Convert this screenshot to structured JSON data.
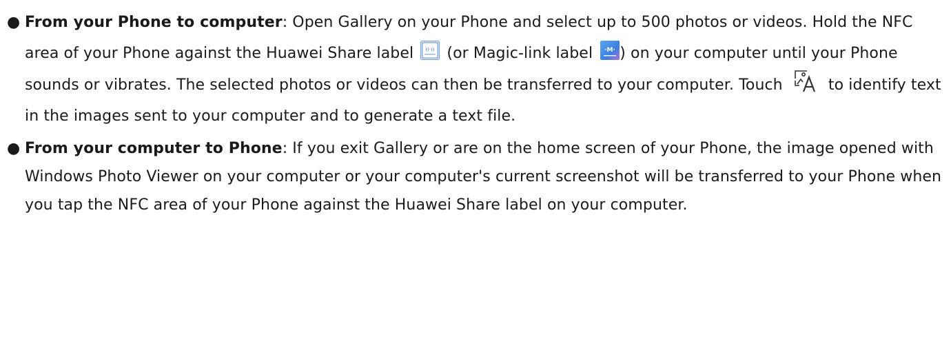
{
  "items": [
    {
      "title": "From your Phone to computer",
      "t1": ": Open Gallery on your Phone and select up to 500 photos or videos. Hold the NFC area of your Phone against the Huawei Share label",
      "t2": "(or Magic-link label",
      "t3": ")",
      "t4": "on your computer until your Phone sounds or vibrates. The selected photos or videos can then be transferred to your computer. Touch",
      "t5": "to identify text in the images sent to your computer and to generate a text file."
    },
    {
      "title": "From your computer to Phone",
      "t1": ": If you exit Gallery or are on the home screen of your Phone, the image opened with Windows Photo Viewer on your computer or your computer's current screenshot will be transferred to your Phone when you tap the NFC area of your Phone against the Huawei Share label on your computer."
    }
  ],
  "icons": {
    "huawei_share_label": "huawei-share-label-icon",
    "magic_link_label": "magic-link-label-icon",
    "text_recognition": "text-recognition-icon"
  },
  "colors": {
    "huawei_label_bg": "#4a86c8",
    "magic_label_bg": "#3a8fe0",
    "ocr_icon": "#333333"
  }
}
